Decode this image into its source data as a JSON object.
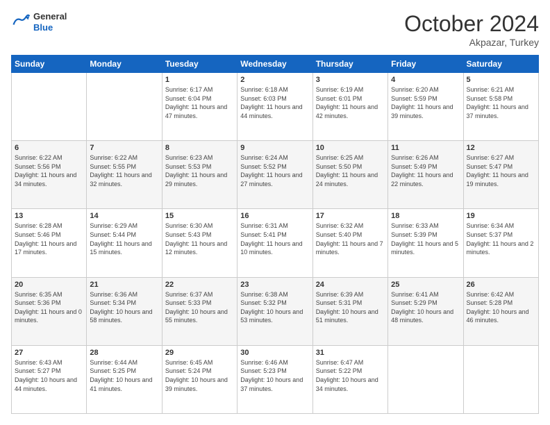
{
  "header": {
    "logo_general": "General",
    "logo_blue": "Blue",
    "month": "October 2024",
    "location": "Akpazar, Turkey"
  },
  "weekdays": [
    "Sunday",
    "Monday",
    "Tuesday",
    "Wednesday",
    "Thursday",
    "Friday",
    "Saturday"
  ],
  "weeks": [
    [
      {
        "day": null
      },
      {
        "day": null
      },
      {
        "day": "1",
        "sunrise": "6:17 AM",
        "sunset": "6:04 PM",
        "daylight": "11 hours and 47 minutes."
      },
      {
        "day": "2",
        "sunrise": "6:18 AM",
        "sunset": "6:03 PM",
        "daylight": "11 hours and 44 minutes."
      },
      {
        "day": "3",
        "sunrise": "6:19 AM",
        "sunset": "6:01 PM",
        "daylight": "11 hours and 42 minutes."
      },
      {
        "day": "4",
        "sunrise": "6:20 AM",
        "sunset": "5:59 PM",
        "daylight": "11 hours and 39 minutes."
      },
      {
        "day": "5",
        "sunrise": "6:21 AM",
        "sunset": "5:58 PM",
        "daylight": "11 hours and 37 minutes."
      }
    ],
    [
      {
        "day": "6",
        "sunrise": "6:22 AM",
        "sunset": "5:56 PM",
        "daylight": "11 hours and 34 minutes."
      },
      {
        "day": "7",
        "sunrise": "6:22 AM",
        "sunset": "5:55 PM",
        "daylight": "11 hours and 32 minutes."
      },
      {
        "day": "8",
        "sunrise": "6:23 AM",
        "sunset": "5:53 PM",
        "daylight": "11 hours and 29 minutes."
      },
      {
        "day": "9",
        "sunrise": "6:24 AM",
        "sunset": "5:52 PM",
        "daylight": "11 hours and 27 minutes."
      },
      {
        "day": "10",
        "sunrise": "6:25 AM",
        "sunset": "5:50 PM",
        "daylight": "11 hours and 24 minutes."
      },
      {
        "day": "11",
        "sunrise": "6:26 AM",
        "sunset": "5:49 PM",
        "daylight": "11 hours and 22 minutes."
      },
      {
        "day": "12",
        "sunrise": "6:27 AM",
        "sunset": "5:47 PM",
        "daylight": "11 hours and 19 minutes."
      }
    ],
    [
      {
        "day": "13",
        "sunrise": "6:28 AM",
        "sunset": "5:46 PM",
        "daylight": "11 hours and 17 minutes."
      },
      {
        "day": "14",
        "sunrise": "6:29 AM",
        "sunset": "5:44 PM",
        "daylight": "11 hours and 15 minutes."
      },
      {
        "day": "15",
        "sunrise": "6:30 AM",
        "sunset": "5:43 PM",
        "daylight": "11 hours and 12 minutes."
      },
      {
        "day": "16",
        "sunrise": "6:31 AM",
        "sunset": "5:41 PM",
        "daylight": "11 hours and 10 minutes."
      },
      {
        "day": "17",
        "sunrise": "6:32 AM",
        "sunset": "5:40 PM",
        "daylight": "11 hours and 7 minutes."
      },
      {
        "day": "18",
        "sunrise": "6:33 AM",
        "sunset": "5:39 PM",
        "daylight": "11 hours and 5 minutes."
      },
      {
        "day": "19",
        "sunrise": "6:34 AM",
        "sunset": "5:37 PM",
        "daylight": "11 hours and 2 minutes."
      }
    ],
    [
      {
        "day": "20",
        "sunrise": "6:35 AM",
        "sunset": "5:36 PM",
        "daylight": "11 hours and 0 minutes."
      },
      {
        "day": "21",
        "sunrise": "6:36 AM",
        "sunset": "5:34 PM",
        "daylight": "10 hours and 58 minutes."
      },
      {
        "day": "22",
        "sunrise": "6:37 AM",
        "sunset": "5:33 PM",
        "daylight": "10 hours and 55 minutes."
      },
      {
        "day": "23",
        "sunrise": "6:38 AM",
        "sunset": "5:32 PM",
        "daylight": "10 hours and 53 minutes."
      },
      {
        "day": "24",
        "sunrise": "6:39 AM",
        "sunset": "5:31 PM",
        "daylight": "10 hours and 51 minutes."
      },
      {
        "day": "25",
        "sunrise": "6:41 AM",
        "sunset": "5:29 PM",
        "daylight": "10 hours and 48 minutes."
      },
      {
        "day": "26",
        "sunrise": "6:42 AM",
        "sunset": "5:28 PM",
        "daylight": "10 hours and 46 minutes."
      }
    ],
    [
      {
        "day": "27",
        "sunrise": "6:43 AM",
        "sunset": "5:27 PM",
        "daylight": "10 hours and 44 minutes."
      },
      {
        "day": "28",
        "sunrise": "6:44 AM",
        "sunset": "5:25 PM",
        "daylight": "10 hours and 41 minutes."
      },
      {
        "day": "29",
        "sunrise": "6:45 AM",
        "sunset": "5:24 PM",
        "daylight": "10 hours and 39 minutes."
      },
      {
        "day": "30",
        "sunrise": "6:46 AM",
        "sunset": "5:23 PM",
        "daylight": "10 hours and 37 minutes."
      },
      {
        "day": "31",
        "sunrise": "6:47 AM",
        "sunset": "5:22 PM",
        "daylight": "10 hours and 34 minutes."
      },
      {
        "day": null
      },
      {
        "day": null
      }
    ]
  ],
  "labels": {
    "sunrise_prefix": "Sunrise: ",
    "sunset_prefix": "Sunset: ",
    "daylight_prefix": "Daylight: "
  }
}
